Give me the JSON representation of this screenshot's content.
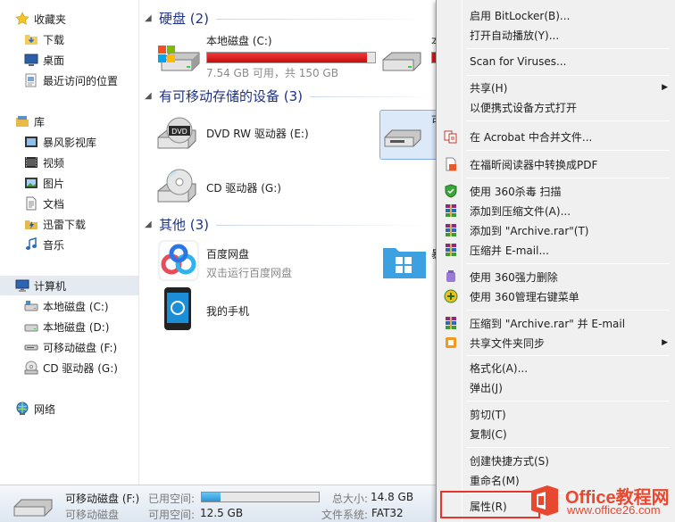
{
  "sidebar": {
    "favorites": {
      "label": "收藏夹",
      "icon": "star-icon"
    },
    "fav_items": [
      {
        "label": "下载",
        "icon": "folder-download-icon"
      },
      {
        "label": "桌面",
        "icon": "desktop-icon"
      },
      {
        "label": "最近访问的位置",
        "icon": "recent-places-icon"
      }
    ],
    "library": {
      "label": "库",
      "icon": "library-icon"
    },
    "lib_items": [
      {
        "label": "暴风影视库",
        "icon": "video-library-icon"
      },
      {
        "label": "视频",
        "icon": "video-icon"
      },
      {
        "label": "图片",
        "icon": "picture-icon"
      },
      {
        "label": "文档",
        "icon": "document-icon"
      },
      {
        "label": "迅雷下载",
        "icon": "thunder-download-icon"
      },
      {
        "label": "音乐",
        "icon": "music-icon"
      }
    ],
    "computer": {
      "label": "计算机",
      "icon": "computer-icon"
    },
    "computer_items": [
      {
        "label": "本地磁盘 (C:)",
        "icon": "drive-icon"
      },
      {
        "label": "本地磁盘 (D:)",
        "icon": "drive-icon"
      },
      {
        "label": "可移动磁盘 (F:)",
        "icon": "removable-drive-icon"
      },
      {
        "label": "CD 驱动器 (G:)",
        "icon": "cd-drive-icon"
      }
    ],
    "network": {
      "label": "网络",
      "icon": "network-icon"
    }
  },
  "groups": {
    "hard_disk": "硬盘 (2)",
    "removable": "有可移动存储的设备 (3)",
    "other": "其他 (3)"
  },
  "tiles": {
    "c_drive": {
      "name": "本地磁盘 (C:)",
      "free": "7.54 GB 可用，共 150 GB",
      "used_fraction": 0.95
    },
    "d_drive_partial": {
      "name": "本"
    },
    "dvd": {
      "name": "DVD RW 驱动器 (E:)",
      "badge": "DVD"
    },
    "removable_partial": {
      "name": "可"
    },
    "cd": {
      "name": "CD 驱动器 (G:)"
    },
    "baidu": {
      "name": "百度网盘",
      "sub": "双击运行百度网盘"
    },
    "other_partial": {
      "name": "暴"
    },
    "phone": {
      "name": "我的手机"
    }
  },
  "menu": {
    "items": [
      {
        "label": "启用 BitLocker(B)...",
        "icon": ""
      },
      {
        "label": "打开自动播放(Y)...",
        "icon": ""
      },
      {
        "label": "Scan for Viruses...",
        "icon": ""
      },
      {
        "label": "共享(H)",
        "icon": "",
        "submenu": true
      },
      {
        "label": "以便携式设备方式打开",
        "icon": ""
      },
      {
        "label": "在 Acrobat 中合并文件...",
        "icon": "acrobat-icon"
      },
      {
        "label": "在福昕阅读器中转换成PDF",
        "icon": "foxit-icon"
      },
      {
        "label": "使用 360杀毒 扫描",
        "icon": "360-shield-icon"
      },
      {
        "label": "添加到压缩文件(A)...",
        "icon": "winrar-icon"
      },
      {
        "label": "添加到 \"Archive.rar\"(T)",
        "icon": "winrar-icon"
      },
      {
        "label": "压缩并 E-mail...",
        "icon": "winrar-icon"
      },
      {
        "label": "使用 360强力删除",
        "icon": "360-delete-icon"
      },
      {
        "label": "使用 360管理右键菜单",
        "icon": "360-menu-icon"
      },
      {
        "label": "压缩到 \"Archive.rar\" 并 E-mail",
        "icon": "winrar-icon"
      },
      {
        "label": "共享文件夹同步",
        "icon": "sync-icon",
        "submenu": true
      },
      {
        "label": "格式化(A)...",
        "icon": ""
      },
      {
        "label": "弹出(J)",
        "icon": ""
      },
      {
        "label": "剪切(T)",
        "icon": ""
      },
      {
        "label": "复制(C)",
        "icon": ""
      },
      {
        "label": "创建快捷方式(S)",
        "icon": ""
      },
      {
        "label": "重命名(M)",
        "icon": ""
      },
      {
        "label": "属性(R)",
        "icon": ""
      }
    ],
    "submenu_arrow": "▶"
  },
  "status": {
    "name": "可移动磁盘 (F:)",
    "type": "可移动磁盘",
    "used_label": "已用空间:",
    "free_label": "可用空间:",
    "free_value": "12.5 GB",
    "total_label": "总大小:",
    "total_value": "14.8 GB",
    "fs_label": "文件系统:",
    "fs_value": "FAT32",
    "used_fraction": 0.16
  },
  "watermark": {
    "title": "Office教程网",
    "url": "www.office26.com"
  },
  "colors": {
    "link_blue": "#1e3287",
    "drive_bar_full": "#d11a1a",
    "storage_bar": "#2b93d6",
    "highlight_red": "#e8352c",
    "watermark_orange": "#e8482f"
  }
}
